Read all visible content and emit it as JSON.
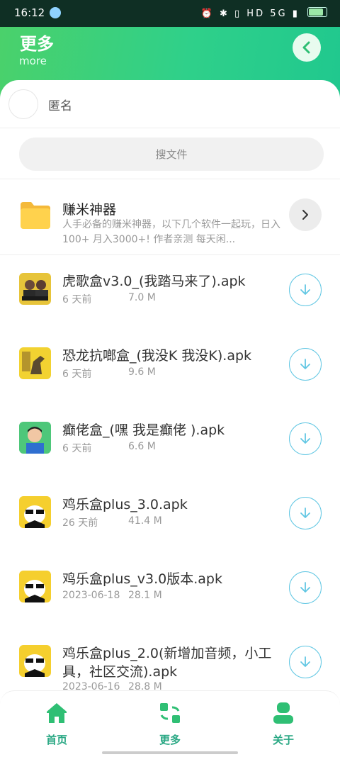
{
  "status_bar": {
    "time": "16:12",
    "icons_text": "⏰ ✱ ▯ HD 5G ▮",
    "battery_level": 0.85
  },
  "header": {
    "title": "更多",
    "subtitle": "more",
    "back_icon": "chevron-left-icon"
  },
  "user": {
    "name": "匿名"
  },
  "search": {
    "placeholder": "搜文件"
  },
  "folder": {
    "name": "赚米神器",
    "description": "人手必备的赚米神器，以下几个软件一起玩，日入100+ 月入3000+! 作者亲测 每天闲...",
    "icon": "folder-icon"
  },
  "files": [
    {
      "name": "虎歌盒v3.0_(我踏马来了).apk",
      "time": "6 天前",
      "size": "7.0 M"
    },
    {
      "name": "恐龙抗啷盒_(我没K 我没K).apk",
      "time": "6 天前",
      "size": "9.6 M"
    },
    {
      "name": "癫佬盒_(嘿 我是癫佬 ).apk",
      "time": "6 天前",
      "size": "6.6 M"
    },
    {
      "name": "鸡乐盒plus_3.0.apk",
      "time": "26 天前",
      "size": "41.4 M"
    },
    {
      "name": "鸡乐盒plus_v3.0版本.apk",
      "time": "2023-06-18",
      "size": "28.1 M"
    },
    {
      "name": "鸡乐盒plus_2.0(新增加音频，小工具，社区交流).apk",
      "time": "2023-06-16",
      "size": "28.8 M"
    }
  ],
  "bottom_nav": [
    {
      "label": "首页",
      "icon": "home-icon"
    },
    {
      "label": "更多",
      "icon": "more-icon"
    },
    {
      "label": "关于",
      "icon": "user-icon"
    }
  ],
  "colors": {
    "accent": "#2fd08a",
    "nav_accent": "#2aa884",
    "download_ring": "#62c7e3"
  }
}
